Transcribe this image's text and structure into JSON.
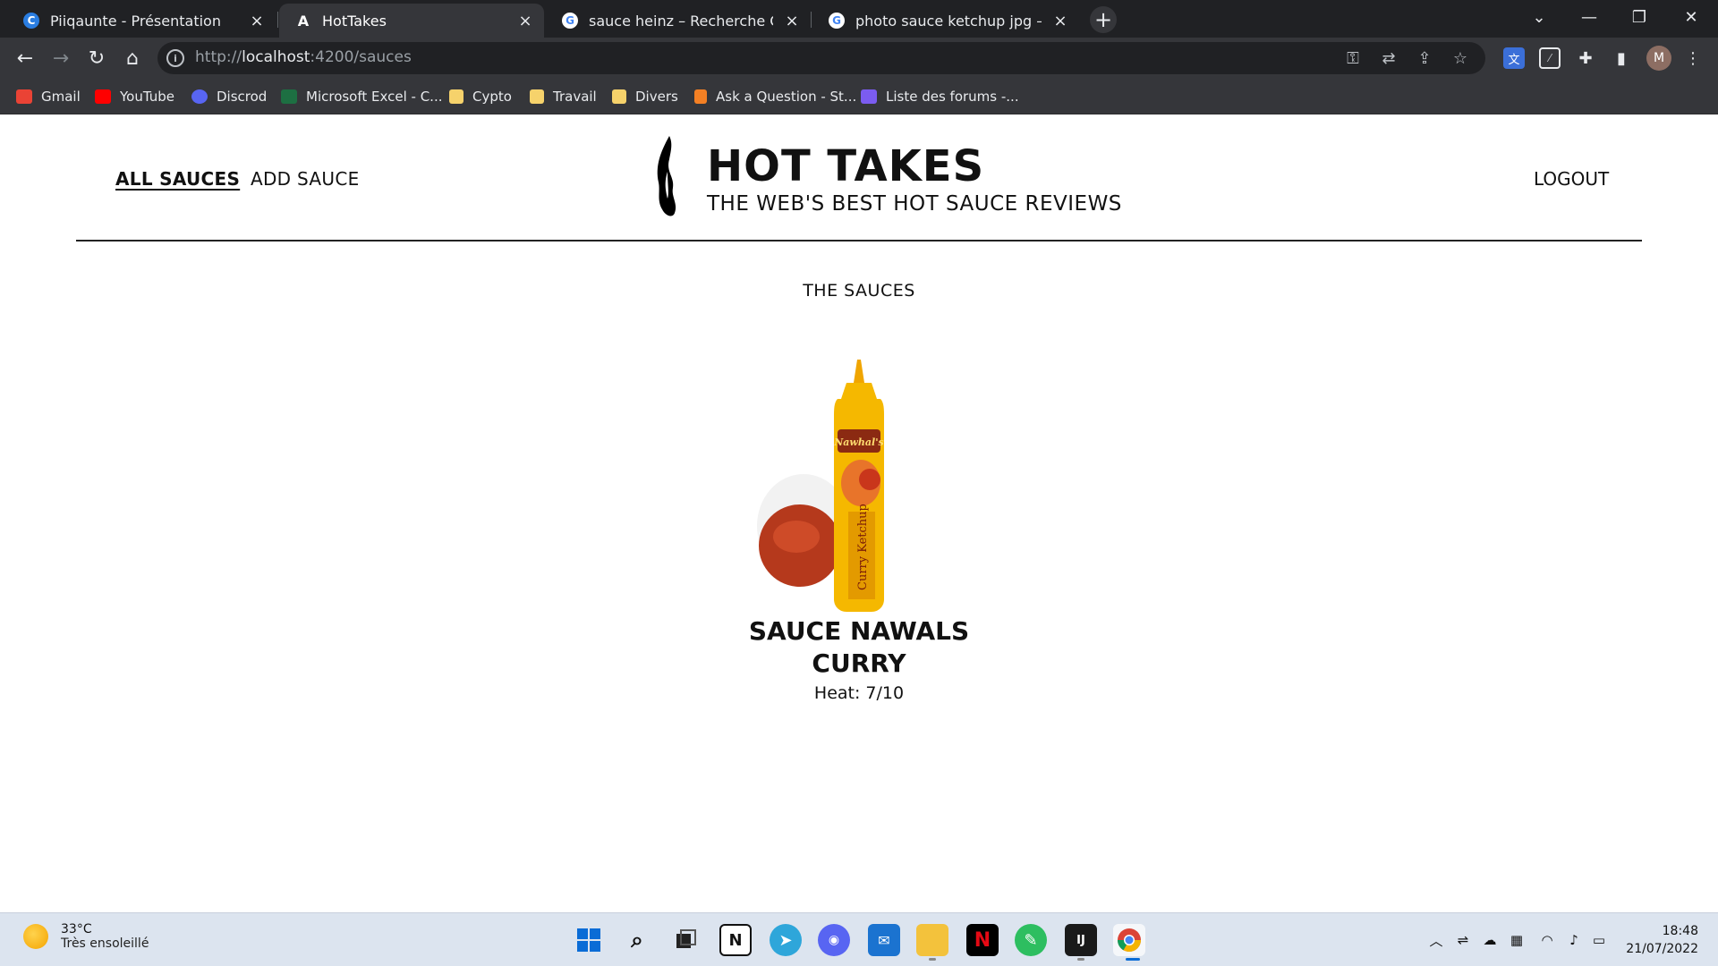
{
  "browser": {
    "tabs": [
      {
        "title": "Piiqaunte - Présentation",
        "active": false
      },
      {
        "title": "HotTakes",
        "active": true
      },
      {
        "title": "sauce heinz – Recherche Google",
        "active": false
      },
      {
        "title": "photo sauce ketchup jpg – Recherche",
        "active": false
      }
    ],
    "url_host": "localhost",
    "url_prefix": "http://",
    "url_suffix": ":4200/sauces",
    "bookmarks": [
      {
        "label": "Gmail",
        "color": "#ea4335"
      },
      {
        "label": "YouTube",
        "color": "#ff0000"
      },
      {
        "label": "Discrod",
        "color": "#5865f2"
      },
      {
        "label": "Microsoft Excel - C...",
        "color": "#1d6f42"
      },
      {
        "label": "Cypto",
        "color": "#f6d26b"
      },
      {
        "label": "Travail",
        "color": "#f6d26b"
      },
      {
        "label": "Divers",
        "color": "#f6d26b"
      },
      {
        "label": "Ask a Question - St...",
        "color": "#f48024"
      },
      {
        "label": "Liste des forums -...",
        "color": "#7b5cf0"
      }
    ],
    "profile_initial": "M"
  },
  "site": {
    "nav": {
      "all_sauces": "ALL SAUCES",
      "add_sauce": "ADD SAUCE",
      "logout": "LOGOUT"
    },
    "title": "HOT TAKES",
    "subtitle": "THE WEB'S BEST HOT SAUCE REVIEWS",
    "section_title": "THE SAUCES",
    "sauces": [
      {
        "name": "SAUCE NAWALS CURRY",
        "heat_text": "Heat: 7/10",
        "heat": 7,
        "brand": "Nawhal's",
        "product": "Curry Ketchup"
      }
    ]
  },
  "taskbar": {
    "weather_temp": "33°C",
    "weather_desc": "Très ensoleillé",
    "time": "18:48",
    "date": "21/07/2022"
  },
  "colors": {
    "chrome_dark": "#202124",
    "chrome_toolbar": "#35363a",
    "bottle_yellow": "#f5b800",
    "bottle_red": "#c9361b"
  }
}
